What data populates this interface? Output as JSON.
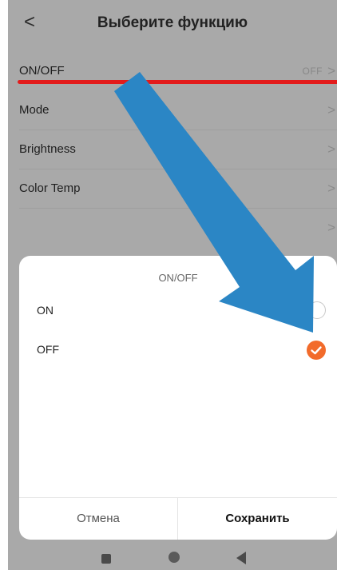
{
  "header": {
    "back_glyph": "<",
    "title": "Выберите функцию"
  },
  "function_list": [
    {
      "label": "ON/OFF",
      "value": "OFF",
      "chevron": ">"
    },
    {
      "label": "Mode",
      "value": "",
      "chevron": ">"
    },
    {
      "label": "Brightness",
      "value": "",
      "chevron": ">"
    },
    {
      "label": "Color Temp",
      "value": "",
      "chevron": ">"
    },
    {
      "label": "",
      "value": "",
      "chevron": ">"
    }
  ],
  "sheet": {
    "title": "ON/OFF",
    "options": [
      {
        "label": "ON",
        "selected": false
      },
      {
        "label": "OFF",
        "selected": true
      }
    ],
    "cancel_label": "Отмена",
    "save_label": "Сохранить"
  },
  "annotations": {
    "underline_color": "#e31b1b",
    "arrow_color": "#2b86c5"
  },
  "colors": {
    "accent": "#f26b2b",
    "dim_background": "#a9a9a9"
  },
  "icons": {
    "back": "chevron-left-icon",
    "row_chevron": "chevron-right-icon",
    "checked": "check-circle-icon",
    "unchecked": "radio-empty-icon",
    "nav_recents": "square-icon",
    "nav_home": "circle-icon",
    "nav_back": "triangle-back-icon"
  }
}
